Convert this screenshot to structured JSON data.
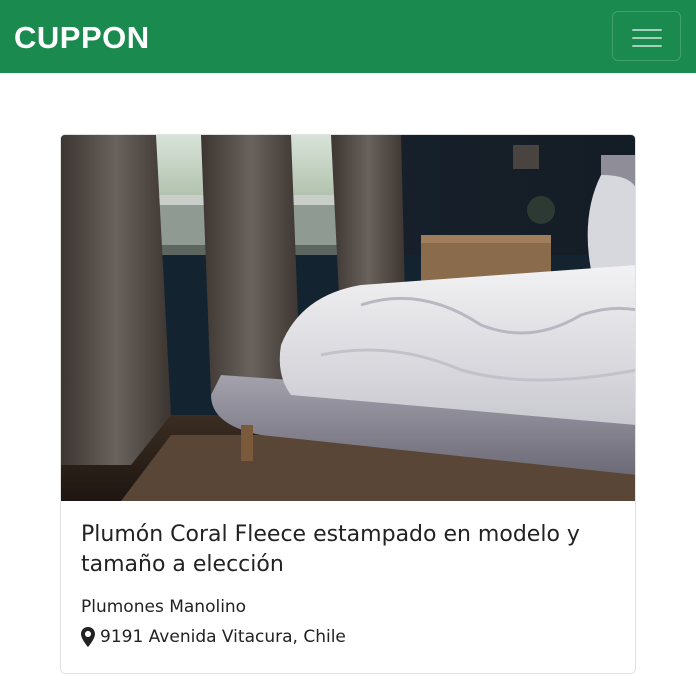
{
  "navbar": {
    "brand": "CUPPON",
    "toggler_icon": "hamburger-menu-icon",
    "bg_color": "#1b8a4f"
  },
  "deal": {
    "image_description_icon": "bedroom-photo",
    "title": "Plumón Coral Fleece estampado en modelo y tamaño a elección",
    "vendor": "Plumones Manolino",
    "address_icon": "map-marker-icon",
    "address": "9191 Avenida Vitacura, Chile"
  }
}
